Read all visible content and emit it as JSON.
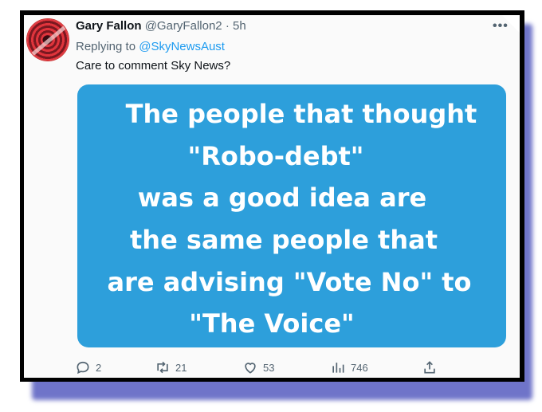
{
  "tweet": {
    "author_name": "Gary Fallon",
    "handle": "@GaryFallon2",
    "separator": "·",
    "time": "5h",
    "more_label": "•••",
    "replying_prefix": "Replying to",
    "replying_to": "@SkyNewsAust",
    "text": "Care to comment Sky News?"
  },
  "media": {
    "lines": [
      "The people that thought",
      "\"Robo-debt\"",
      "was a good idea are",
      "the same people that",
      "are advising \"Vote No\" to",
      "\"The Voice\""
    ],
    "background_color": "#2d9fdb"
  },
  "actions": {
    "replies": "2",
    "retweets": "21",
    "likes": "53",
    "views": "746"
  },
  "icons": [
    "reply-icon",
    "retweet-icon",
    "like-icon",
    "views-icon",
    "share-icon",
    "more-icon"
  ]
}
